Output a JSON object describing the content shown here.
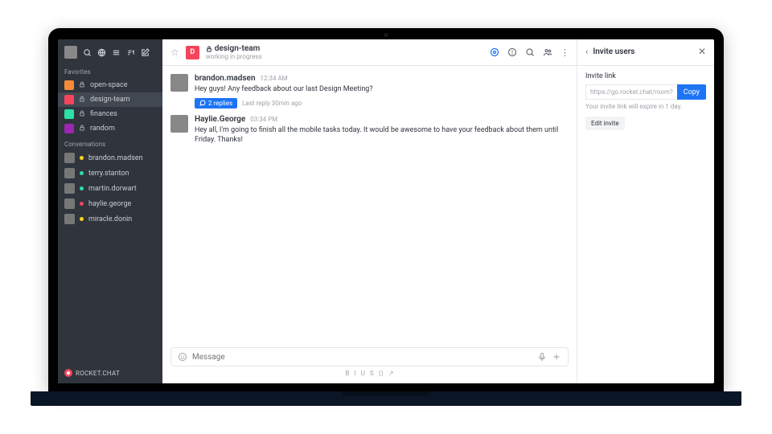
{
  "sidebar": {
    "sections": [
      {
        "title": "Favorites",
        "kind": "channels",
        "items": [
          {
            "name": "open-space",
            "color": "#F38C39",
            "private": true
          },
          {
            "name": "design-team",
            "color": "#F5455C",
            "private": true,
            "active": true
          },
          {
            "name": "finances",
            "color": "#2DE0A5",
            "private": true
          },
          {
            "name": "random",
            "color": "#9C27B0",
            "private": true
          }
        ]
      },
      {
        "title": "Conversations",
        "kind": "dms",
        "items": [
          {
            "name": "brandon.madsen",
            "status": "#FFD21F"
          },
          {
            "name": "terry.stanton",
            "status": "#2DE0A5"
          },
          {
            "name": "martin.dorwart",
            "status": "#2DE0A5"
          },
          {
            "name": "haylie.george",
            "status": "#F5455C"
          },
          {
            "name": "miracle.donin",
            "status": "#FFD21F"
          }
        ]
      }
    ],
    "brand": "ROCKET.CHAT"
  },
  "header": {
    "avatar": "D",
    "title": "design-team",
    "private": true,
    "topic": "working in progress"
  },
  "messages": [
    {
      "author": "brandon.madsen",
      "time": "12:34 AM",
      "text": "Hey guys! Any feedback about our last Design Meeting?",
      "thread": {
        "replies_label": "2 replies",
        "meta": "Last reply 30min ago"
      }
    },
    {
      "author": "Haylie.George",
      "time": "03:34 PM",
      "text": "Hey all, I'm going to finish all the mobile tasks today. It would be awesome to have your feedback about them until Friday. Thanks!"
    }
  ],
  "composer": {
    "placeholder": "Message"
  },
  "format_bar": [
    "B",
    "I",
    "U",
    "S",
    "⟨⟩",
    "↗"
  ],
  "panel": {
    "title": "Invite users",
    "link_label": "Invite link",
    "link_value": "https://go.rocket.chat/room?host=…",
    "copy": "Copy",
    "expire": "Your invite link will expire in 1 day.",
    "edit": "Edit invite"
  }
}
